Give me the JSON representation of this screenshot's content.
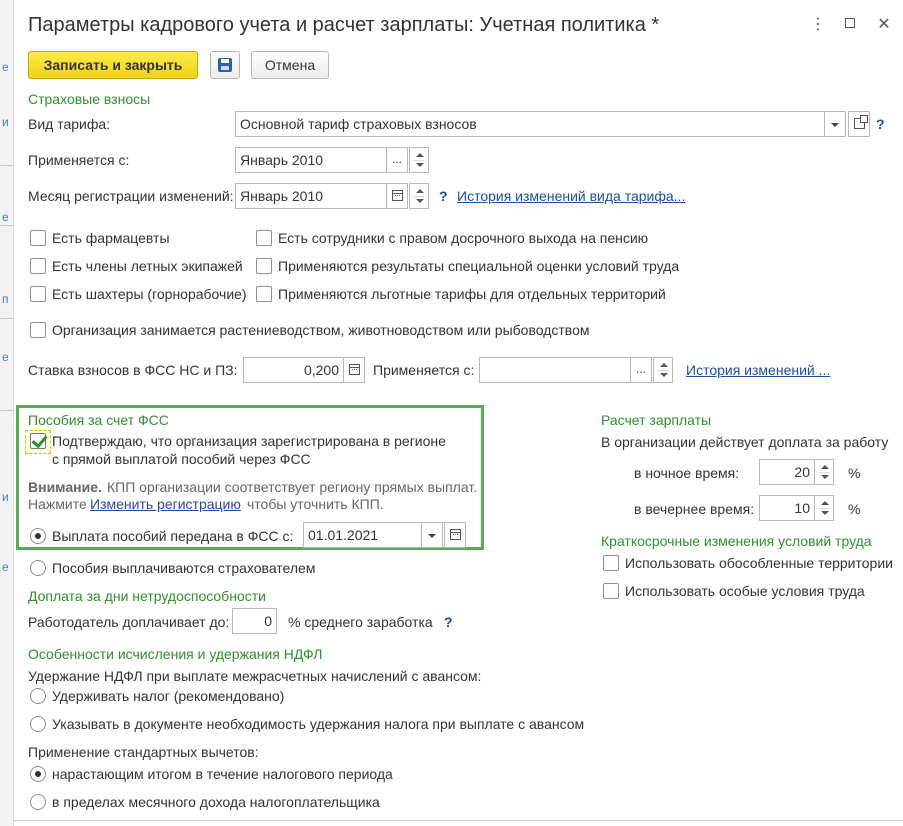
{
  "window": {
    "title": "Параметры кадрового учета и расчет зарплаты: Учетная политика *",
    "menu_icon": "more-vertical-icon",
    "maximize_icon": "maximize-icon",
    "close_icon": "close-icon"
  },
  "left_strip_letters": [
    "е",
    "и",
    "е",
    "п",
    "е",
    "и",
    "е"
  ],
  "toolbar": {
    "save_close_label": "Записать и закрыть",
    "save_icon": "floppy-disk-icon",
    "cancel_label": "Отмена"
  },
  "insurance": {
    "section_title": "Страховые взносы",
    "tariff_label": "Вид тарифа:",
    "tariff_value": "Основной тариф страховых взносов",
    "applies_from_label": "Применяется с:",
    "applies_from_value": "Январь 2010",
    "month_reg_label": "Месяц регистрации изменений:",
    "month_reg_value": "Январь 2010",
    "history_link": "История изменений вида тарифа...",
    "help": "?",
    "checkboxes_left": [
      {
        "label": "Есть фармацевты",
        "checked": false
      },
      {
        "label": "Есть члены летных экипажей",
        "checked": false
      },
      {
        "label": "Есть шахтеры (горнорабочие)",
        "checked": false
      }
    ],
    "checkboxes_right": [
      {
        "label": "Есть сотрудники с правом досрочного выхода на пенсию",
        "checked": false
      },
      {
        "label": "Применяются результаты специальной оценки условий труда",
        "checked": false
      },
      {
        "label": "Применяются льготные тарифы для отдельных территорий",
        "checked": false
      }
    ],
    "agro_label": "Организация занимается растениеводством, животноводством или рыбоводством",
    "fss_rate_label": "Ставка взносов в ФСС НС и ПЗ:",
    "fss_rate_value": "0,200",
    "fss_applies_label": "Применяется с:",
    "fss_applies_value": "",
    "fss_history_link": "История изменений ..."
  },
  "benefits": {
    "section_title": "Пособия за счет ФСС",
    "confirm_line1": "Подтверждаю, что организация зарегистрирована в регионе",
    "confirm_line2": "с прямой выплатой пособий через ФСС",
    "confirm_checked": true,
    "warning_bold": "Внимание.",
    "warning_text": "КПП организации соответствует региону прямых выплат.",
    "press_text": "Нажмите",
    "change_reg_link": "Изменить регистрацию",
    "press_text2": "чтобы уточнить КПП.",
    "radio_transferred_label": "Выплата пособий передана в ФСС с:",
    "radio_transferred_date": "01.01.2021",
    "radio_insurer_label": "Пособия выплачиваются страхователем",
    "selected": "transferred"
  },
  "payroll": {
    "section_title": "Расчет зарплаты",
    "bonus_label": "В организации действует доплата за работу",
    "night_label": "в ночное время:",
    "night_value": "20",
    "evening_label": "в вечернее время:",
    "evening_value": "10",
    "percent": "%",
    "short_term_title": "Краткосрочные изменения условий труда",
    "separate_territories": "Использовать обособленные территории",
    "special_conditions": "Использовать особые условия труда"
  },
  "sick_pay": {
    "section_title": "Доплата за дни нетрудоспособности",
    "employer_label": "Работодатель доплачивает до:",
    "employer_value": "0",
    "suffix": "% среднего заработка",
    "help": "?"
  },
  "ndfl": {
    "section_title": "Особенности исчисления и удержания НДФЛ",
    "withholding_label": "Удержание НДФЛ при выплате межрасчетных начислений с авансом:",
    "option_withhold": "Удерживать налог (рекомендовано)",
    "option_document": "Указывать в документе необходимость удержания налога при выплате с авансом",
    "deductions_label": "Применение стандартных вычетов:",
    "option_cumulative": "нарастающим итогом в течение налогового периода",
    "option_monthly": "в пределах месячного дохода налогоплательщика"
  }
}
